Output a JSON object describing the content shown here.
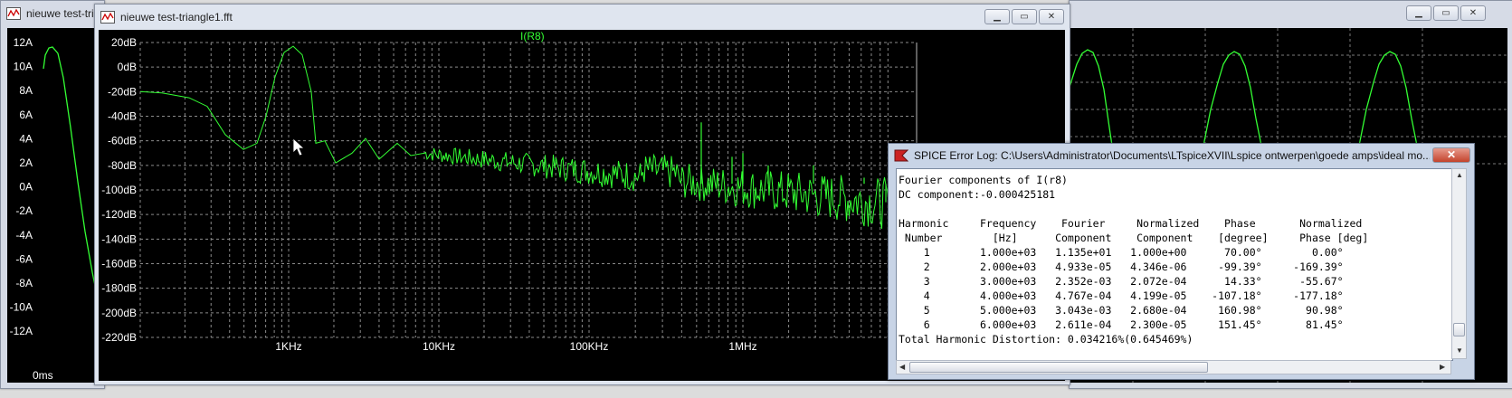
{
  "windows": {
    "back_left": {
      "title": "nieuwe test-tri"
    },
    "fft": {
      "title": "nieuwe test-triangle1.fft",
      "trace_label": "I(R8)"
    },
    "log": {
      "title": "SPICE Error Log: C:\\Users\\Administrator\\Documents\\LTspiceXVII\\Lspice ontwerpen\\goede amps\\ideal mo...",
      "lines": [
        "Fourier components of I(r8)",
        "DC component:-0.000425181",
        "",
        "Harmonic     Frequency    Fourier     Normalized    Phase       Normalized",
        " Number        [Hz]      Component    Component    [degree]     Phase [deg]",
        "    1        1.000e+03   1.135e+01   1.000e+00      70.00°        0.00°",
        "    2        2.000e+03   4.933e-05   4.346e-06     -99.39°     -169.39°",
        "    3        3.000e+03   2.352e-03   2.072e-04      14.33°      -55.67°",
        "    4        4.000e+03   4.767e-04   4.199e-05    -107.18°     -177.18°",
        "    5        5.000e+03   3.043e-03   2.680e-04     160.98°       90.98°",
        "    6        6.000e+03   2.611e-04   2.300e-05     151.45°       81.45°",
        "Total Harmonic Distortion: 0.034216%(0.645469%)"
      ]
    }
  },
  "time_axis": {
    "y_labels": [
      "12A",
      "10A",
      "8A",
      "6A",
      "4A",
      "2A",
      "0A",
      "-2A",
      "-4A",
      "-6A",
      "-8A",
      "-10A",
      "-12A"
    ],
    "x_label_start": "0ms"
  },
  "fft_axis": {
    "y_labels": [
      "20dB",
      "0dB",
      "-20dB",
      "-40dB",
      "-60dB",
      "-80dB",
      "-100dB",
      "-120dB",
      "-140dB",
      "-160dB",
      "-180dB",
      "-200dB",
      "-220dB"
    ],
    "x_labels": [
      "1KHz",
      "10KHz",
      "100KHz",
      "1MHz"
    ]
  },
  "colors": {
    "trace": "#33ff33",
    "plot_bg": "#000000",
    "grid": "#8a8a8a"
  },
  "icons": {
    "window_app": "ltspice-plot-icon",
    "log_app": "spice-log-icon"
  }
}
